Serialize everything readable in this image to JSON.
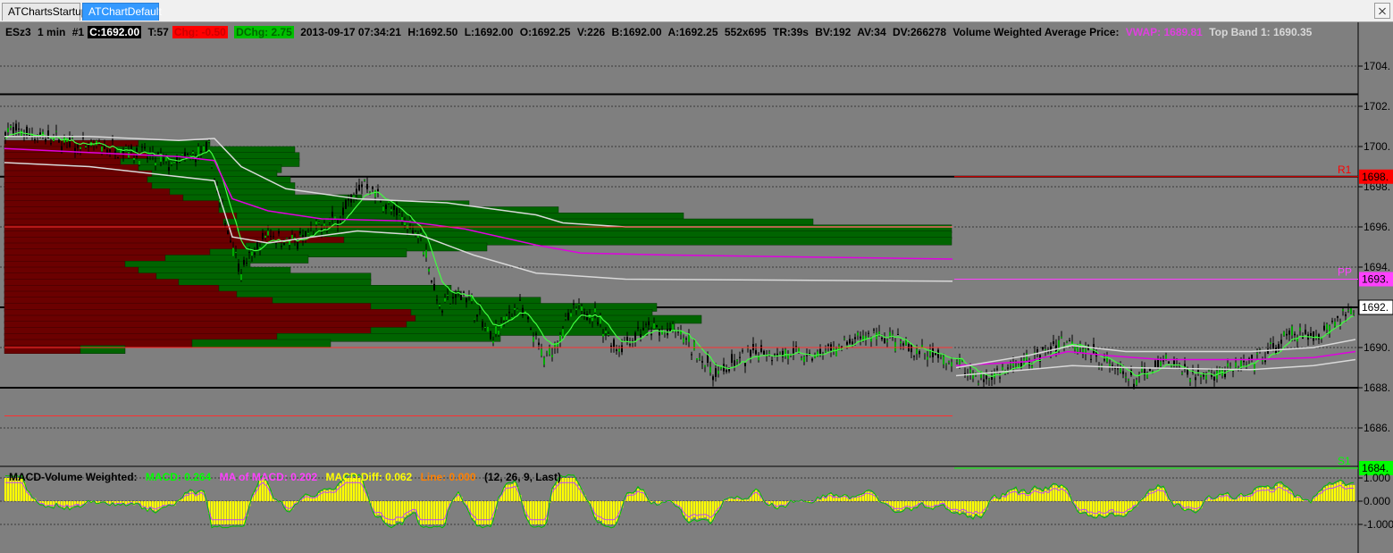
{
  "tabs": [
    {
      "label": "ATChartsStartup",
      "active": false
    },
    {
      "label": "ATChartDefault",
      "active": true
    }
  ],
  "header": {
    "symbol": "ESz3",
    "interval": "1 min",
    "index": "#1",
    "close": "C:1692.00",
    "ticks": "T:57",
    "chg": "Chg: -0.50",
    "dchg": "DChg: 2.75",
    "datetime": "2013-09-17 07:34:21",
    "high": "H:1692.50",
    "low": "L:1692.00",
    "open": "O:1692.25",
    "volume": "V:226",
    "bid": "B:1692.00",
    "ask": "A:1692.25",
    "size": "552x695",
    "tr": "TR:39s",
    "bv": "BV:192",
    "av": "AV:34",
    "dv": "DV:266278",
    "vwap_label": "Volume Weighted Average Price:",
    "vwap_value": "VWAP: 1689.81",
    "top_band": "Top Band 1: 1690.35"
  },
  "price_axis": {
    "ticks": [
      "1704.",
      "1702.",
      "1700.",
      "1698.",
      "1696.",
      "1694.",
      "1692.",
      "1690.",
      "1688.",
      "1686."
    ],
    "tick_values": [
      1704,
      1702,
      1700,
      1698,
      1696,
      1694,
      1692,
      1690,
      1688,
      1686
    ],
    "current_price_label": "1692.",
    "pivot_tags": [
      {
        "name": "R1",
        "tag": "1698.",
        "value": 1698.5,
        "color": "#ff0000"
      },
      {
        "name": "PP",
        "tag": "1693.",
        "value": 1693.4,
        "color": "#ff40ff"
      },
      {
        "name": "S1",
        "tag": "1684.",
        "value": 1684.0,
        "color": "#00ff00"
      }
    ]
  },
  "macd": {
    "title": "MACD-Volume Weighted:",
    "macd": "MACD: 0.264",
    "ma": "MA of MACD: 0.202",
    "diff": "MACD Diff: 0.062",
    "line": "Line: 0.000",
    "params": "(12, 26, 9, Last)",
    "axis_ticks": [
      "1.000",
      "0.000",
      "-1.000"
    ],
    "axis_values": [
      1,
      0,
      -1
    ]
  },
  "colors": {
    "background": "#7f7f7f",
    "sell_volume": "#6b0000",
    "buy_volume": "#006400",
    "vwap": "#e000e0",
    "band": "#d9d9d9",
    "ma_fast": "#40ff40",
    "macd_hist": "#ffff00",
    "r1": "#ff0000",
    "pp": "#ff40ff",
    "s1": "#00ff00"
  }
}
